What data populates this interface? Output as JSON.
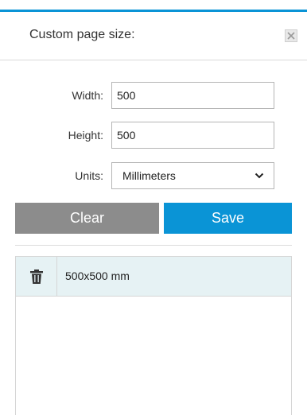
{
  "dialog": {
    "title": "Custom page size:",
    "close_icon": "close-icon"
  },
  "form": {
    "width": {
      "label": "Width:",
      "value": "500"
    },
    "height": {
      "label": "Height:",
      "value": "500"
    },
    "units": {
      "label": "Units:",
      "selected": "Millimeters"
    }
  },
  "buttons": {
    "clear_label": "Clear",
    "save_label": "Save"
  },
  "sizes_list": {
    "items": [
      {
        "label": "500x500 mm",
        "icon": "trash-icon"
      }
    ]
  },
  "colors": {
    "accent": "#0a94d6",
    "clear_button": "#8c8c8c",
    "selected_row": "#e6f2f4"
  }
}
